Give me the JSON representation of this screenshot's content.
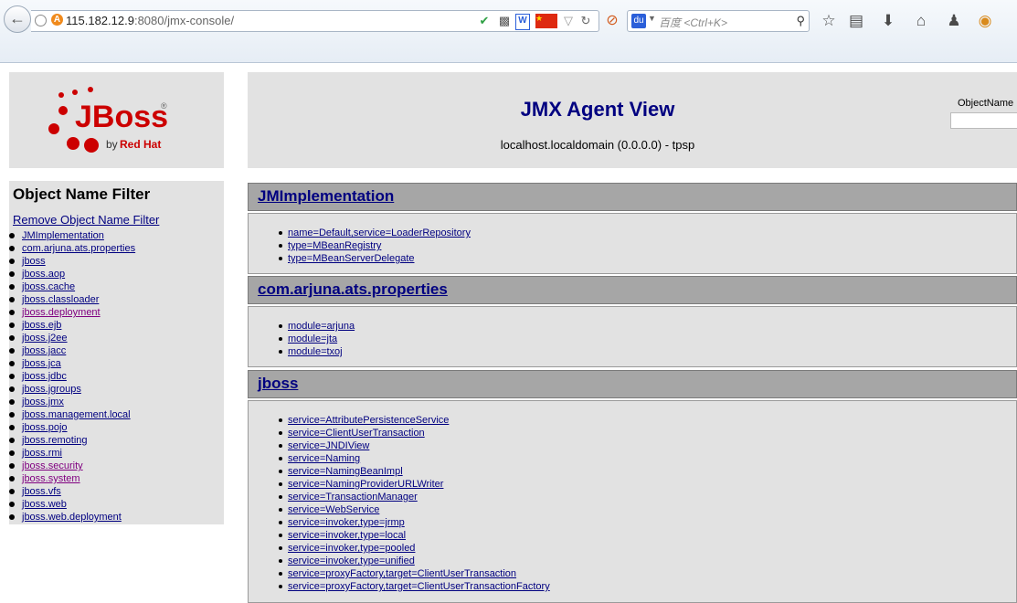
{
  "browser": {
    "url_host": "115.182.12.9",
    "url_path": ":8080/jmx-console/",
    "search_placeholder": "百度 <Ctrl+K>",
    "search_engine_glyph": "du"
  },
  "logo": {
    "brand": "JBoss",
    "byline_prefix": "by",
    "byline_company": "Red Hat",
    "registered": "®"
  },
  "agent": {
    "title": "JMX Agent View",
    "subtitle": "localhost.localdomain (0.0.0.0) - tpsp",
    "objname_label": "ObjectName Filter",
    "objname_value": ""
  },
  "filter": {
    "title": "Object Name Filter",
    "remove_label": "Remove Object Name Filter",
    "items": [
      {
        "label": "JMImplementation",
        "visited": false
      },
      {
        "label": "com.arjuna.ats.properties",
        "visited": false
      },
      {
        "label": "jboss",
        "visited": false
      },
      {
        "label": "jboss.aop",
        "visited": false
      },
      {
        "label": "jboss.cache",
        "visited": false
      },
      {
        "label": "jboss.classloader",
        "visited": false
      },
      {
        "label": "jboss.deployment",
        "visited": true
      },
      {
        "label": "jboss.ejb",
        "visited": false
      },
      {
        "label": "jboss.j2ee",
        "visited": false
      },
      {
        "label": "jboss.jacc",
        "visited": false
      },
      {
        "label": "jboss.jca",
        "visited": false
      },
      {
        "label": "jboss.jdbc",
        "visited": false
      },
      {
        "label": "jboss.jgroups",
        "visited": false
      },
      {
        "label": "jboss.jmx",
        "visited": false
      },
      {
        "label": "jboss.management.local",
        "visited": false
      },
      {
        "label": "jboss.pojo",
        "visited": false
      },
      {
        "label": "jboss.remoting",
        "visited": false
      },
      {
        "label": "jboss.rmi",
        "visited": false
      },
      {
        "label": "jboss.security",
        "visited": true
      },
      {
        "label": "jboss.system",
        "visited": true
      },
      {
        "label": "jboss.vfs",
        "visited": false
      },
      {
        "label": "jboss.web",
        "visited": false
      },
      {
        "label": "jboss.web.deployment",
        "visited": false
      }
    ]
  },
  "domains": [
    {
      "name": "JMImplementation",
      "mbeans": [
        "name=Default,service=LoaderRepository",
        "type=MBeanRegistry",
        "type=MBeanServerDelegate"
      ]
    },
    {
      "name": "com.arjuna.ats.properties",
      "mbeans": [
        "module=arjuna",
        "module=jta",
        "module=txoj"
      ]
    },
    {
      "name": "jboss",
      "mbeans": [
        "service=AttributePersistenceService",
        "service=ClientUserTransaction",
        "service=JNDIView",
        "service=Naming",
        "service=NamingBeanImpl",
        "service=NamingProviderURLWriter",
        "service=TransactionManager",
        "service=WebService",
        "service=invoker,type=jrmp",
        "service=invoker,type=local",
        "service=invoker,type=pooled",
        "service=invoker,type=unified",
        "service=proxyFactory,target=ClientUserTransaction",
        "service=proxyFactory,target=ClientUserTransactionFactory"
      ]
    }
  ],
  "colors": {
    "link": "#000080",
    "visited": "#800080",
    "panel": "#e2e2e2",
    "header": "#a6a6a6",
    "logo_red": "#cc0000"
  }
}
